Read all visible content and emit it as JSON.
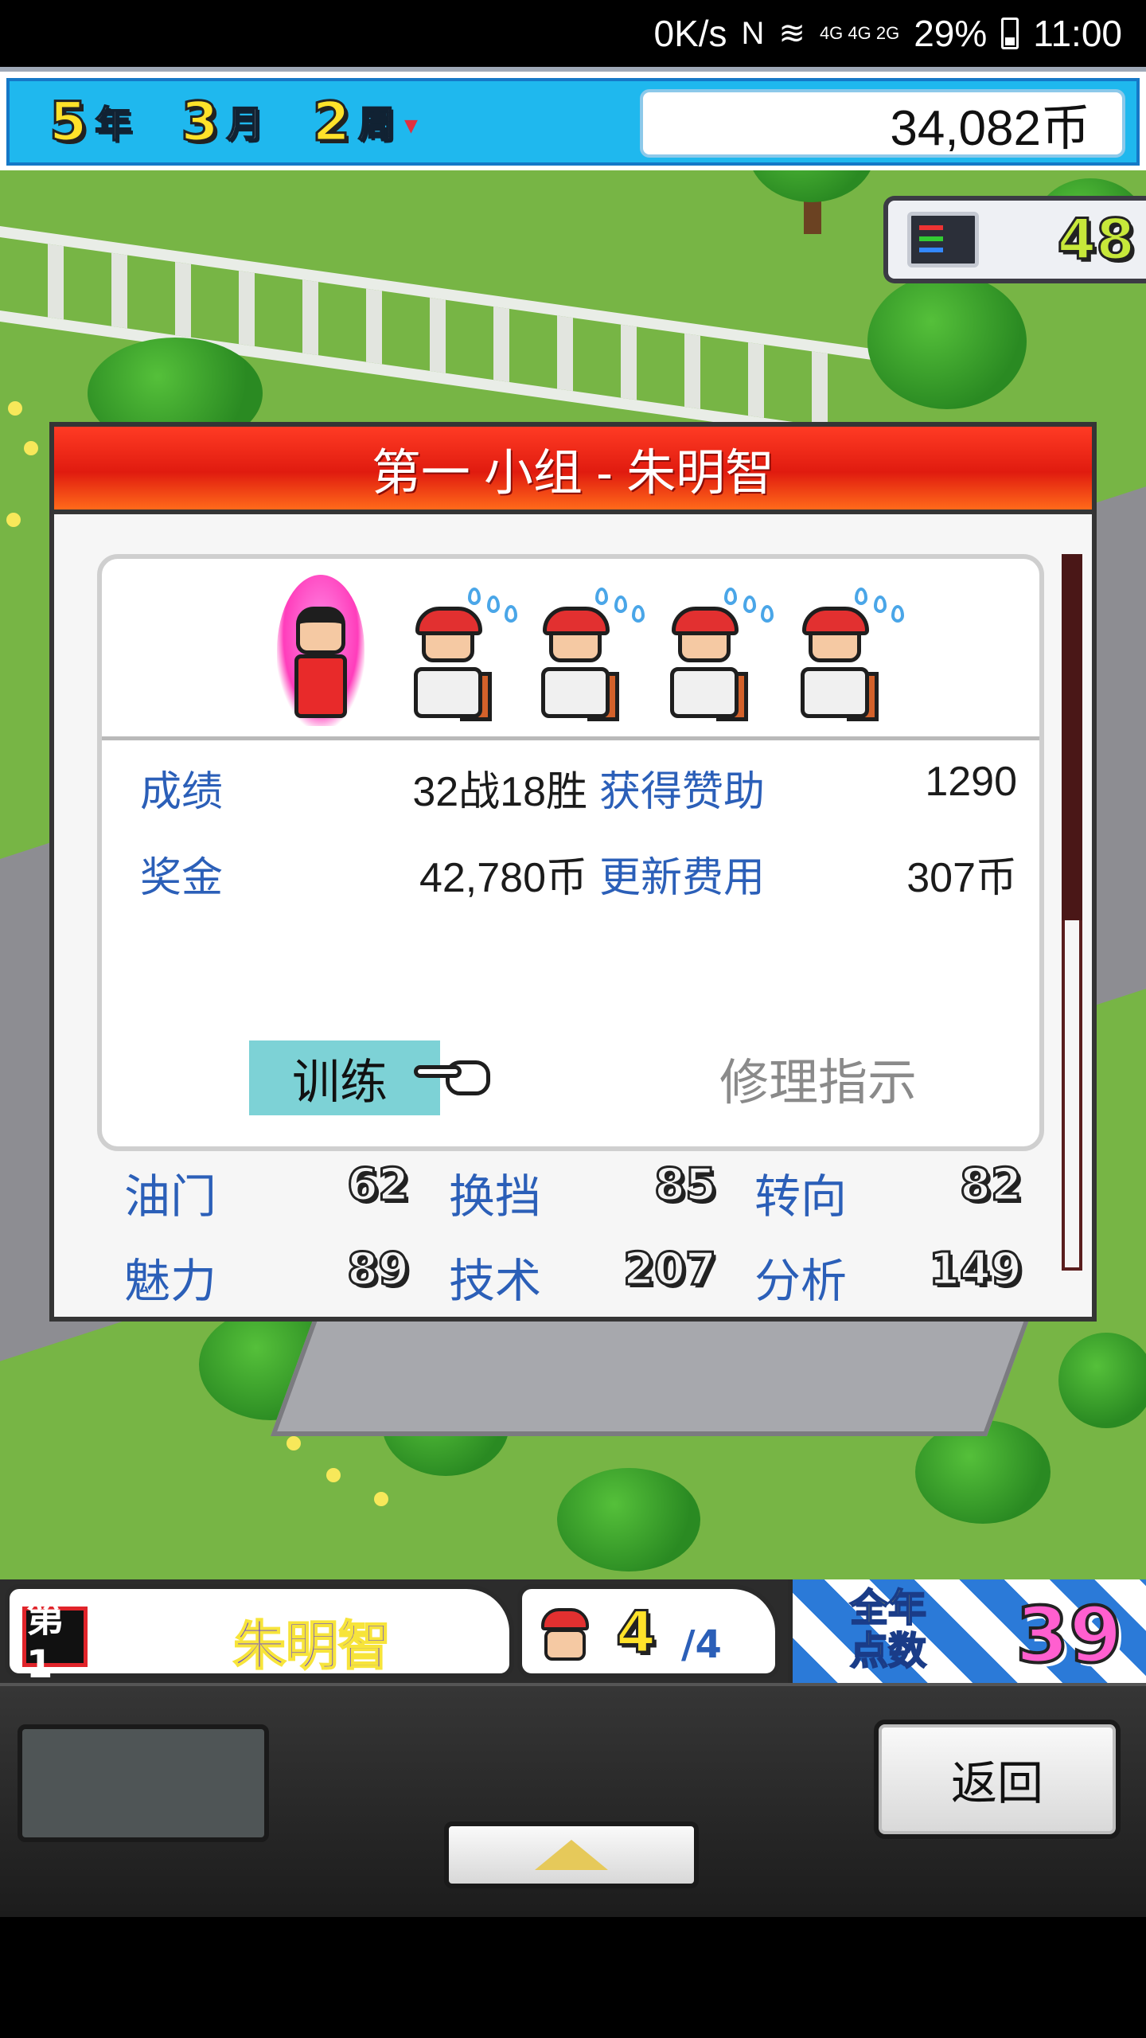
{
  "status_bar": {
    "net_speed": "0K/s",
    "nfc": "N",
    "network": "4G 4G 2G",
    "battery": "29%",
    "time": "11:00"
  },
  "hud": {
    "year_num": "5",
    "year_unit": "年",
    "month_num": "3",
    "month_unit": "月",
    "week_num": "2",
    "week_unit": "周",
    "money": "34,082币"
  },
  "pc_badge": {
    "count": "48"
  },
  "dialog": {
    "title": "第一 小组 - 朱明智",
    "stats": {
      "record_label": "成绩",
      "record_value": "32战18胜",
      "sponsor_label": "获得赞助",
      "sponsor_value": "1290",
      "prize_label": "奖金",
      "prize_value": "42,780币",
      "renew_label": "更新费用",
      "renew_value": "307币"
    },
    "buttons": {
      "train": "训练",
      "repair": "修理指示"
    },
    "params": {
      "throttle_label": "油门",
      "throttle_value": "62",
      "shift_label": "换挡",
      "shift_value": "85",
      "steer_label": "转向",
      "steer_value": "82",
      "charm_label": "魅力",
      "charm_value": "89",
      "tech_label": "技术",
      "tech_value": "207",
      "analysis_label": "分析",
      "analysis_value": "149"
    }
  },
  "bottom_bar": {
    "rank_badge": "第1",
    "driver_name": "朱明智",
    "crew_count": "4",
    "crew_total": "/4",
    "points_label_line1": "全年",
    "points_label_line2": "点数",
    "points_value": "39"
  },
  "panel": {
    "back": "返回"
  }
}
